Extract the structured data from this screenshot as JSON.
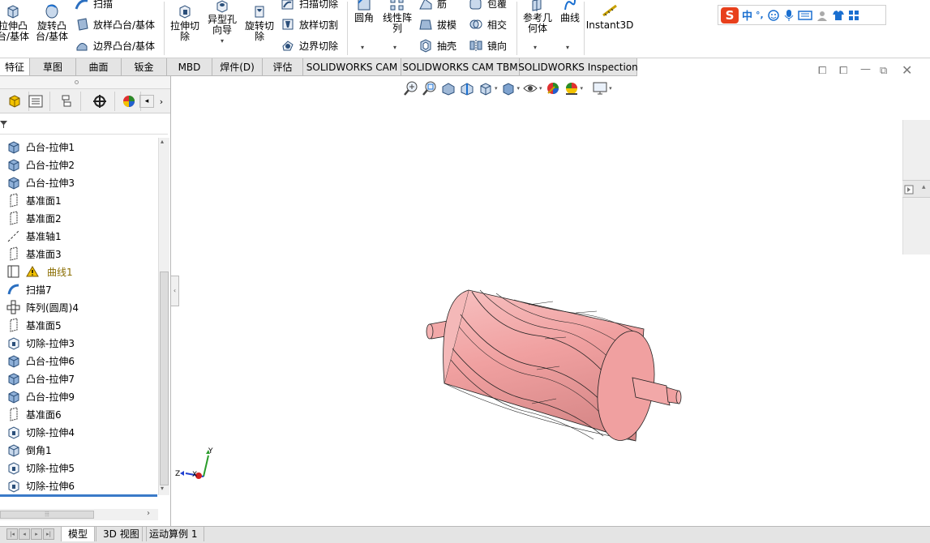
{
  "ribbon": {
    "extrude_boss": "拉伸凸\n台/基体",
    "revolve_boss": "旋转凸\n台/基体",
    "sweep": "扫描",
    "loft_boss": "放样凸台/基体",
    "boundary_boss": "边界凸台/基体",
    "extrude_cut": "拉伸切\n除",
    "hole_wizard": "异型孔\n向导",
    "revolve_cut": "旋转切\n除",
    "sweep_cut": "扫描切除",
    "loft_cut": "放样切割",
    "boundary_cut": "边界切除",
    "fillet": "圆角",
    "linear_pattern": "线性阵\n列",
    "rib": "筋",
    "draft": "拔模",
    "shell": "抽壳",
    "wrap": "包覆",
    "intersect": "相交",
    "mirror": "镜向",
    "ref_geometry": "参考几\n何体",
    "curves": "曲线",
    "instant3d": "Instant3D"
  },
  "ime": {
    "logo": "S",
    "lang": "中",
    "punct": "°,"
  },
  "command_tabs": [
    "特征",
    "草图",
    "曲面",
    "钣金",
    "MBD",
    "焊件(D)",
    "评估",
    "SOLIDWORKS CAM",
    "SOLIDWORKS CAM TBM",
    "SOLIDWORKS Inspection"
  ],
  "feature_tree": [
    {
      "label": "凸台-拉伸1",
      "icon": "boss-extrude-icon"
    },
    {
      "label": "凸台-拉伸2",
      "icon": "boss-extrude-icon"
    },
    {
      "label": "凸台-拉伸3",
      "icon": "boss-extrude-icon"
    },
    {
      "label": "基准面1",
      "icon": "plane-icon"
    },
    {
      "label": "基准面2",
      "icon": "plane-icon"
    },
    {
      "label": "基准轴1",
      "icon": "axis-icon"
    },
    {
      "label": "基准面3",
      "icon": "plane-icon"
    },
    {
      "label": "曲线1",
      "icon": "curve-icon",
      "warning": true
    },
    {
      "label": "扫描7",
      "icon": "sweep-icon"
    },
    {
      "label": "阵列(圆周)4",
      "icon": "circular-pattern-icon"
    },
    {
      "label": "基准面5",
      "icon": "plane-icon"
    },
    {
      "label": "切除-拉伸3",
      "icon": "cut-extrude-icon"
    },
    {
      "label": "凸台-拉伸6",
      "icon": "boss-extrude-icon"
    },
    {
      "label": "凸台-拉伸7",
      "icon": "boss-extrude-icon"
    },
    {
      "label": "凸台-拉伸9",
      "icon": "boss-extrude-icon"
    },
    {
      "label": "基准面6",
      "icon": "plane-icon"
    },
    {
      "label": "切除-拉伸4",
      "icon": "cut-extrude-icon"
    },
    {
      "label": "倒角1",
      "icon": "chamfer-icon"
    },
    {
      "label": "切除-拉伸5",
      "icon": "cut-extrude-icon"
    },
    {
      "label": "切除-拉伸6",
      "icon": "cut-extrude-icon"
    }
  ],
  "triad": {
    "x": "X",
    "y": "Y",
    "z": "Z"
  },
  "bottom_tabs": [
    "模型",
    "3D 视图",
    "运动算例 1"
  ],
  "colors": {
    "model": "#f0a0a0",
    "accent": "#3a7ac8"
  }
}
